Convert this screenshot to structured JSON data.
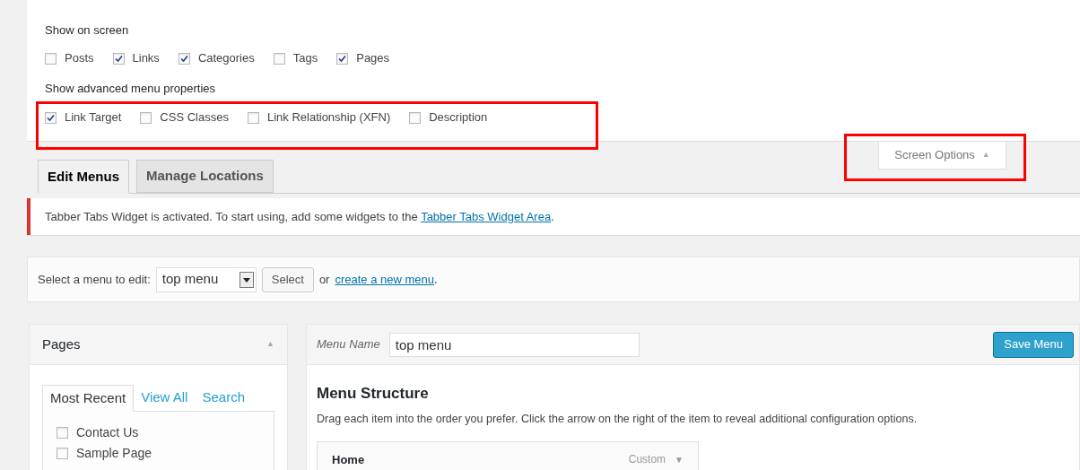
{
  "screen_options": {
    "show_on_screen_label": "Show on screen",
    "show_on_screen": [
      {
        "label": "Posts",
        "checked": false
      },
      {
        "label": "Links",
        "checked": true
      },
      {
        "label": "Categories",
        "checked": true
      },
      {
        "label": "Tags",
        "checked": false
      },
      {
        "label": "Pages",
        "checked": true
      }
    ],
    "advanced_label": "Show advanced menu properties",
    "advanced": [
      {
        "label": "Link Target",
        "checked": true
      },
      {
        "label": "CSS Classes",
        "checked": false
      },
      {
        "label": "Link Relationship (XFN)",
        "checked": false
      },
      {
        "label": "Description",
        "checked": false
      }
    ],
    "toggle": {
      "label": "Screen Options",
      "arrow": "▲"
    }
  },
  "tabs": [
    {
      "label": "Edit Menus",
      "selected": true
    },
    {
      "label": "Manage Locations",
      "selected": false
    }
  ],
  "notice": {
    "text": "Tabber Tabs Widget is activated. To start using, add some widgets to the",
    "link": "Tabber Tabs Widget Area",
    "end": "."
  },
  "select_bar": {
    "label": "Select a menu to edit:",
    "value": "top menu",
    "button": "Select",
    "or": "or",
    "link": "create a new menu",
    "end": "."
  },
  "pages_box": {
    "title": "Pages",
    "arrow": "▲",
    "tabs": [
      {
        "label": "Most Recent",
        "selected": true
      },
      {
        "label": "View All",
        "selected": false
      },
      {
        "label": "Search",
        "selected": false
      }
    ],
    "items": [
      {
        "label": "Contact Us",
        "checked": false
      },
      {
        "label": "Sample Page",
        "checked": false
      }
    ]
  },
  "menu_box": {
    "name_label": "Menu Name",
    "name_value": "top menu",
    "save_button": "Save Menu",
    "structure_title": "Menu Structure",
    "structure_hint": "Drag each item into the order you prefer. Click the arrow on the right of the item to reveal additional configuration options.",
    "items": [
      {
        "title": "Home",
        "type": "Custom",
        "arrow": "▼"
      }
    ]
  }
}
